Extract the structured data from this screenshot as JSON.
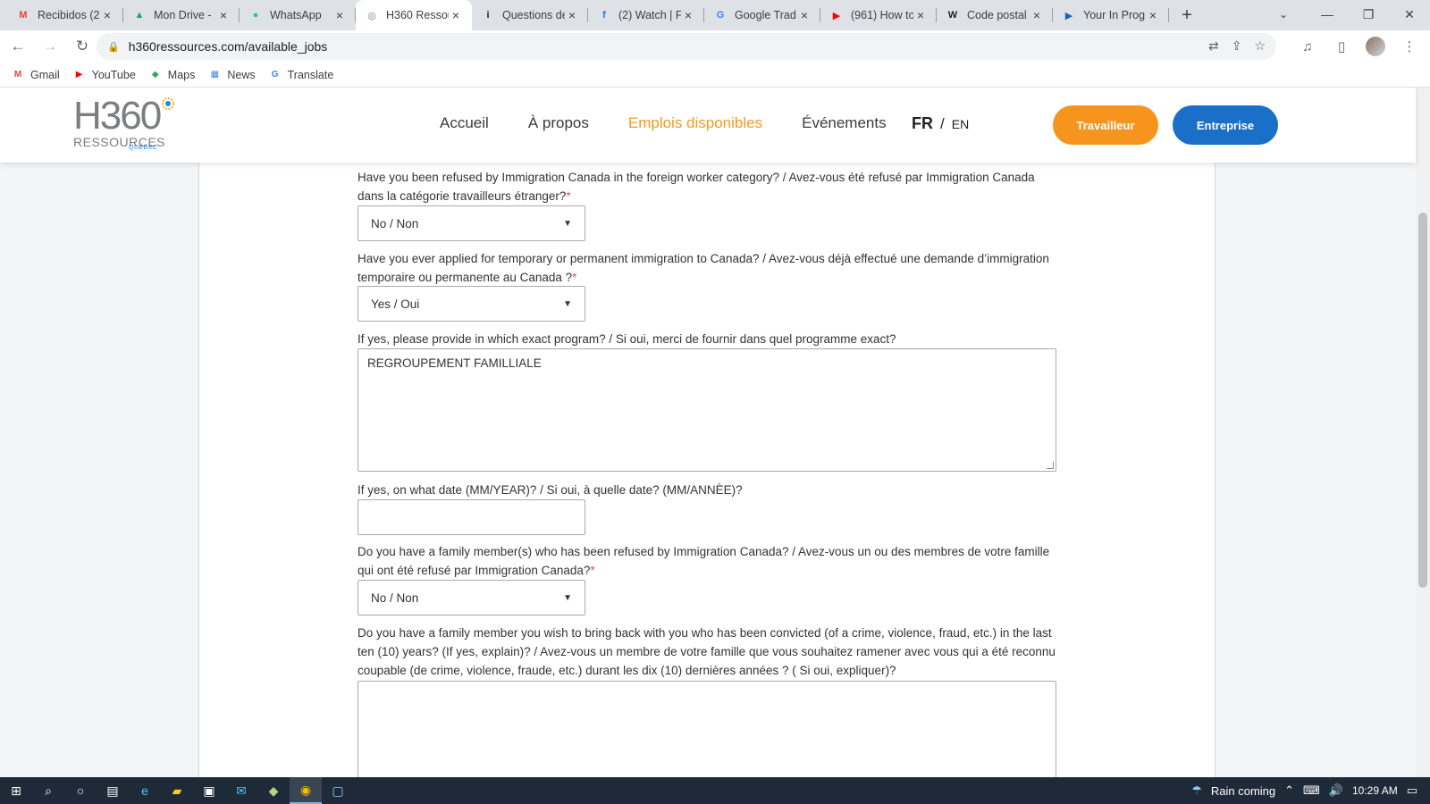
{
  "browser": {
    "tabs": [
      {
        "label": "Recibidos (2",
        "icon": "gmail-icon",
        "color": "#ea4335",
        "glyph": "M"
      },
      {
        "label": "Mon Drive -",
        "icon": "drive-icon",
        "color": "#1fa463",
        "glyph": "▲"
      },
      {
        "label": "WhatsApp",
        "icon": "whatsapp-icon",
        "color": "#25d366",
        "glyph": "●"
      },
      {
        "label": "H360 Ressou",
        "icon": "globe-icon",
        "color": "#7b7d80",
        "glyph": "◎",
        "active": true
      },
      {
        "label": "Questions de",
        "icon": "info-icon",
        "color": "#222222",
        "glyph": "i"
      },
      {
        "label": "(2) Watch | F",
        "icon": "facebook-icon",
        "color": "#1877f2",
        "glyph": "f"
      },
      {
        "label": "Google Trad",
        "icon": "translate-icon",
        "color": "#4285f4",
        "glyph": "G"
      },
      {
        "label": "(961) How to",
        "icon": "youtube-icon",
        "color": "#ff0000",
        "glyph": "▶"
      },
      {
        "label": "Code postal",
        "icon": "wikipedia-icon",
        "color": "#222222",
        "glyph": "W"
      },
      {
        "label": "Your In Prog",
        "icon": "video-icon",
        "color": "#1565c0",
        "glyph": "▶"
      }
    ],
    "url": "h360ressources.com/available_jobs",
    "bookmarks": [
      {
        "label": "Gmail",
        "icon": "gmail-icon",
        "color": "#ea4335",
        "glyph": "M"
      },
      {
        "label": "YouTube",
        "icon": "youtube-icon",
        "color": "#ff0000",
        "glyph": "▶"
      },
      {
        "label": "Maps",
        "icon": "maps-icon",
        "color": "#34a853",
        "glyph": "◆"
      },
      {
        "label": "News",
        "icon": "news-icon",
        "color": "#4285f4",
        "glyph": "▦"
      },
      {
        "label": "Translate",
        "icon": "translate-icon",
        "color": "#4285f4",
        "glyph": "G"
      }
    ]
  },
  "site": {
    "logo_main": "H360",
    "logo_sub": "RESSOURCES",
    "logo_region": "QUÉBEC",
    "nav": [
      {
        "label": "Accueil",
        "active": false
      },
      {
        "label": "À propos",
        "active": false
      },
      {
        "label": "Emplois disponibles",
        "active": true
      },
      {
        "label": "Événements",
        "active": false
      }
    ],
    "lang_fr": "FR",
    "lang_sep": "/",
    "lang_en": "EN",
    "btn_worker": "Travailleur",
    "btn_company": "Entreprise",
    "accent_orange": "#f7941d",
    "accent_blue": "#1a6fc9"
  },
  "form": {
    "q1": {
      "label": "Have you been refused by Immigration Canada in the foreign worker category? / Avez-vous été refusé par Immigration Canada dans la catégorie travailleurs étranger?",
      "required": "*",
      "value": "No / Non"
    },
    "q2": {
      "label": "Have you ever applied for temporary or permanent immigration to Canada? / Avez-vous déjà effectué une demande d’immigration temporaire ou permanente au Canada ?",
      "required": "*",
      "value": "Yes / Oui"
    },
    "q3": {
      "label": "If yes, please provide in which exact program? / Si oui, merci de fournir dans quel programme exact?",
      "value": "REGROUPEMENT FAMILLIALE"
    },
    "q4": {
      "label": "If yes, on what date (MM/YEAR)? / Si oui, à quelle date? (MM/ANNÈE)?",
      "value": ""
    },
    "q5": {
      "label": "Do you have a family member(s) who has been refused by Immigration Canada? / Avez-vous un ou des membres de votre famille qui ont été refusé par Immigration Canada?",
      "required": "*",
      "value": "No / Non"
    },
    "q6": {
      "label": "Do you have a family member you wish to bring back with you who has been convicted (of a crime, violence, fraud, etc.) in the last ten (10) years? (If yes, explain)? / Avez-vous un membre de votre famille que vous souhaitez ramener avec vous qui a été reconnu coupable (de crime, violence, fraude, etc.) durant les dix (10) dernières années ? ( Si oui, expliquer)?",
      "value": ""
    }
  },
  "taskbar": {
    "weather": "Rain coming",
    "time": "10:29 AM"
  }
}
